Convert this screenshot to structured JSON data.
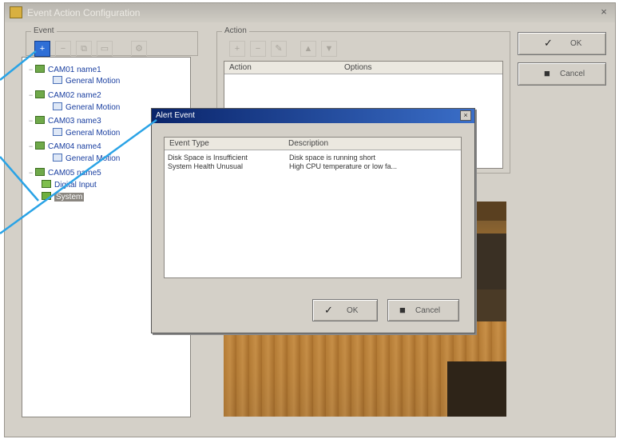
{
  "window": {
    "title": "Event Action Configuration",
    "close_glyph": "×"
  },
  "trigger_group": {
    "label": "Event"
  },
  "action_group": {
    "label": "Action"
  },
  "toolbar": {
    "left": [
      {
        "icon": "add-event-icon",
        "glyph": "+"
      },
      {
        "icon": "remove-icon",
        "glyph": "−"
      },
      {
        "icon": "copy-icon",
        "glyph": "⧉"
      },
      {
        "icon": "paste-icon",
        "glyph": "▭"
      },
      {
        "icon": "settings-icon",
        "glyph": "⚙"
      }
    ],
    "right": [
      {
        "icon": "new-action-icon",
        "glyph": "+"
      },
      {
        "icon": "delete-action-icon",
        "glyph": "−"
      },
      {
        "icon": "edit-action-icon",
        "glyph": "✎"
      },
      {
        "icon": "move-up-icon",
        "glyph": "▲"
      },
      {
        "icon": "move-down-icon",
        "glyph": "▼"
      }
    ]
  },
  "tree": [
    {
      "label": "CAM01 name1",
      "icon": "camera-icon",
      "level": 0
    },
    {
      "label": "General Motion",
      "icon": "motion-icon",
      "level": 1
    },
    {
      "label": "CAM02 name2",
      "icon": "camera-icon",
      "level": 0
    },
    {
      "label": "General Motion",
      "icon": "motion-icon",
      "level": 1
    },
    {
      "label": "CAM03 name3",
      "icon": "camera-icon",
      "level": 0
    },
    {
      "label": "General Motion",
      "icon": "motion-icon",
      "level": 1
    },
    {
      "label": "CAM04 name4",
      "icon": "camera-icon",
      "level": 0
    },
    {
      "label": "General Motion",
      "icon": "motion-icon",
      "level": 1
    },
    {
      "label": "CAM05 name5",
      "icon": "camera-icon",
      "level": 0
    },
    {
      "label": "Digital Input",
      "icon": "digital-input-icon",
      "level": 0
    },
    {
      "label": "System",
      "icon": "system-icon",
      "level": 0,
      "selected": true
    }
  ],
  "action_list": {
    "columns": [
      "Action",
      "Options"
    ]
  },
  "main_buttons": {
    "ok": "OK",
    "cancel": "Cancel",
    "ok_icon": "✓",
    "cancel_icon": "■"
  },
  "dialog": {
    "title": "Alert Event",
    "close_glyph": "×",
    "columns": [
      "Event Type",
      "Description"
    ],
    "rows": [
      {
        "type": "Disk Space is Insufficient",
        "desc": "Disk space is running short"
      },
      {
        "type": "System Health Unusual",
        "desc": "High CPU temperature or low fa..."
      }
    ],
    "ok": "OK",
    "cancel": "Cancel",
    "ok_icon": "✓",
    "cancel_icon": "■"
  },
  "colors": {
    "callout_line": "#2aa3e6",
    "selection": "#2f6fd6",
    "dialog_title": "#0a246a"
  }
}
